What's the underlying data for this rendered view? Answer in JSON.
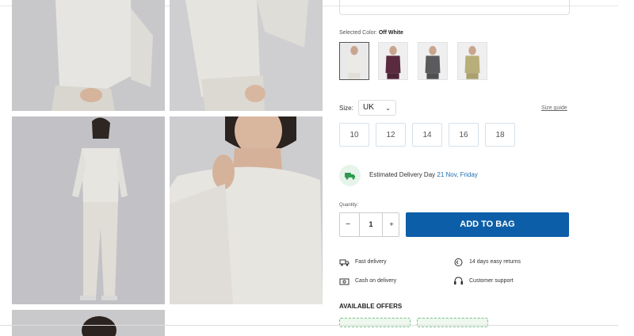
{
  "colors": {
    "accent": "#0d5ea8",
    "delivery_bg": "#e6f4ea",
    "offer_border": "#7ac48a"
  },
  "gallery": {
    "photos": [
      "model-photo-1",
      "model-photo-2",
      "model-photo-3",
      "model-photo-4",
      "model-photo-5"
    ]
  },
  "color_selector": {
    "label": "Selected Color:",
    "value": "Off White",
    "swatches": [
      {
        "name": "Off White",
        "hex": "#e8e6e1",
        "selected": true
      },
      {
        "name": "Plum",
        "hex": "#5a2a3e",
        "selected": false
      },
      {
        "name": "Charcoal",
        "hex": "#5b5b5e",
        "selected": false
      },
      {
        "name": "Olive",
        "hex": "#b8ae7a",
        "selected": false
      }
    ]
  },
  "size": {
    "label": "Size:",
    "unit": "UK",
    "guide": "Size guide",
    "options": [
      "10",
      "12",
      "14",
      "16",
      "18"
    ]
  },
  "delivery": {
    "label": "Estimated Delivery Day",
    "date": "21 Nov, Friday",
    "icon": "truck-icon"
  },
  "quantity": {
    "label": "Quantity:",
    "minus": "−",
    "value": "1",
    "plus": "+"
  },
  "add_to_bag": "ADD TO BAG",
  "features": [
    {
      "label": "Fast delivery",
      "icon": "truck-icon"
    },
    {
      "label": "14 days easy returns",
      "icon": "return-icon"
    },
    {
      "label": "Cash on delivery",
      "icon": "cash-icon"
    },
    {
      "label": "Customer support",
      "icon": "headset-icon"
    }
  ],
  "offers": {
    "title": "AVAILABLE OFFERS"
  }
}
